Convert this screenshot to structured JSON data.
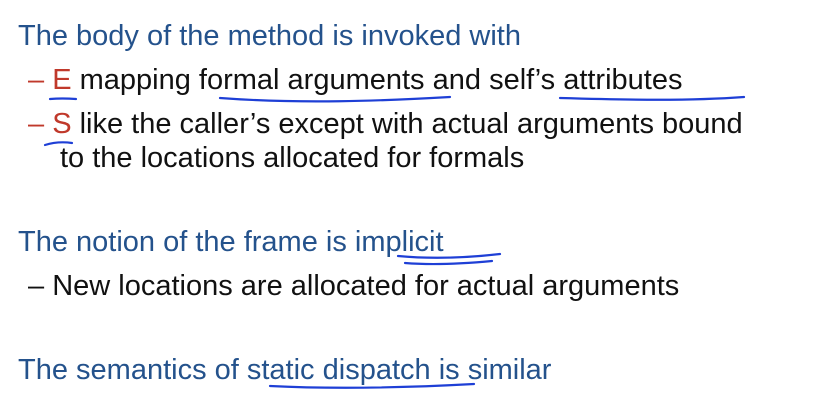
{
  "slide": {
    "line1": "The body of the method is invoked with",
    "bullet1": {
      "dash": "–",
      "letter": "E",
      "text_a": " mapping ",
      "text_b": "formal arguments",
      "text_c": " and ",
      "text_d": "self’s attributes"
    },
    "bullet2": {
      "dash": "–",
      "letter": "S",
      "text": " like the caller’s except with actual arguments bound",
      "cont": "to the locations allocated for formals"
    },
    "line2": {
      "text_a": "The notion of the frame is ",
      "text_b": "implicit"
    },
    "bullet3": {
      "dash": "–",
      "text": " New locations are allocated for actual arguments"
    },
    "line3": {
      "text_a": "The semantics of ",
      "text_b": "static dispatch",
      "text_c": " is similar"
    }
  },
  "colors": {
    "heading_text": "#24528c",
    "bullet_text": "#111111",
    "accent_red": "#c0392b",
    "annotation_ink": "#1e3fd6"
  }
}
